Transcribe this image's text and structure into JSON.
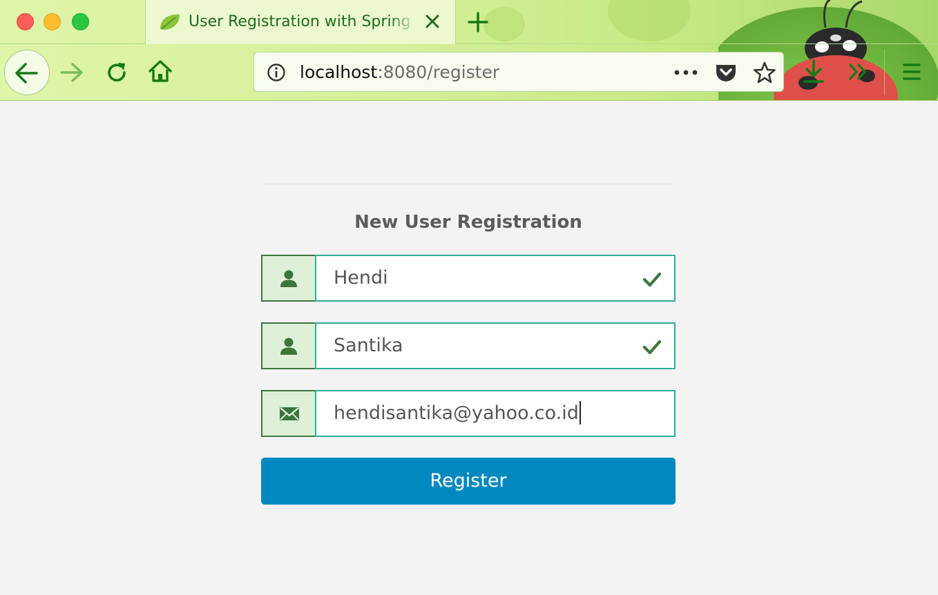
{
  "browser": {
    "tab": {
      "title": "User Registration with Spring Bo",
      "favicon": "spring-leaf-icon"
    },
    "url": {
      "host": "localhost",
      "rest": ":8080/register"
    },
    "toolbar_icons": [
      "back-arrow-icon",
      "forward-arrow-icon",
      "reload-icon",
      "home-icon",
      "info-icon",
      "more-dots-icon",
      "pocket-icon",
      "bookmark-star-icon",
      "download-icon",
      "overflow-chevrons-icon",
      "menu-hamburger-icon"
    ],
    "theme_colors": {
      "toolbar_green": "#d5f09a",
      "icon_green": "#157a15"
    }
  },
  "form": {
    "title": "New User Registration",
    "fields": [
      {
        "icon": "user-icon",
        "value": "Hendi",
        "valid": true
      },
      {
        "icon": "user-icon",
        "value": "Santika",
        "valid": true
      },
      {
        "icon": "envelope-icon",
        "value": "hendisantika@yahoo.co.id",
        "valid": false
      }
    ],
    "submit_label": "Register",
    "colors": {
      "addon_bg": "#dff0d8",
      "addon_border": "#3c763d",
      "input_border": "#2bb092",
      "button_bg": "#0089bf"
    }
  }
}
